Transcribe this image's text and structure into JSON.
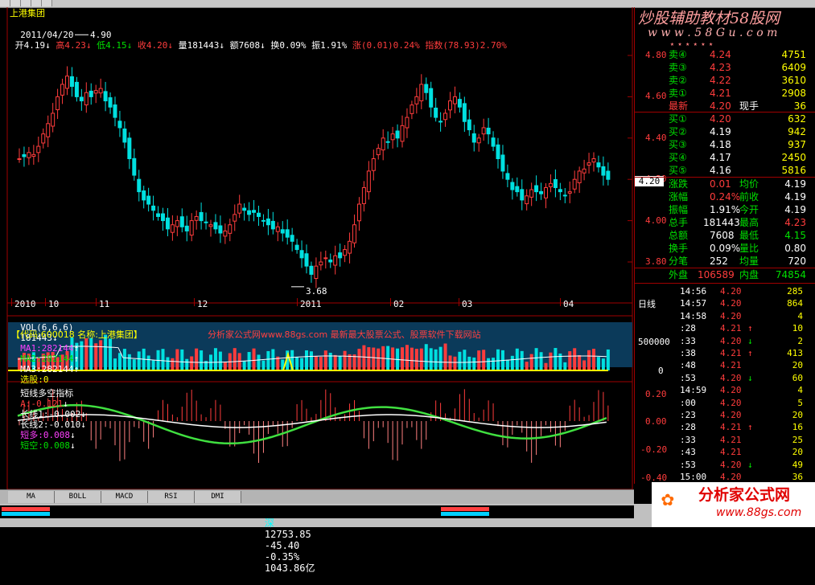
{
  "header": {
    "stock_name": "上港集团",
    "date": "2011/04/20",
    "stats": [
      {
        "label": "开",
        "value": "4.19",
        "arrow": "↓",
        "color": "#ffffff"
      },
      {
        "label": "高",
        "value": "4.23",
        "arrow": "↓",
        "color": "#ff3c3c"
      },
      {
        "label": "低",
        "value": "4.15",
        "arrow": "↓",
        "color": "#00e000"
      },
      {
        "label": "收",
        "value": "4.20",
        "arrow": "↓",
        "color": "#ff3c3c"
      },
      {
        "label": "量",
        "value": "181443",
        "arrow": "↓",
        "color": "#ffffff"
      },
      {
        "label": "额",
        "value": "7608",
        "arrow": "↓",
        "color": "#ffffff"
      },
      {
        "label": "换",
        "value": "0.09%",
        "arrow": "",
        "color": "#ffffff"
      },
      {
        "label": "振",
        "value": "1.91%",
        "arrow": "",
        "color": "#ffffff"
      },
      {
        "label": "涨",
        "value": "(0.01)0.24%",
        "arrow": "",
        "color": "#ff3c3c"
      },
      {
        "label": "指数",
        "value": "(78.93)2.70%",
        "arrow": "",
        "color": "#ff3c3c"
      }
    ]
  },
  "watermark": {
    "title": "炒股辅助教材58股网",
    "url": "w w w . 5 8 G u . c o m",
    "stars": "★ ★ ★ ★ ★ ★"
  },
  "price_axis": {
    "labels": [
      "4.80",
      "4.60",
      "4.40",
      "4.20",
      "4.00",
      "3.80"
    ],
    "current": "4.20",
    "high_label": "4.90",
    "low_label": "3.68"
  },
  "date_axis": {
    "labels": [
      "2010",
      "10",
      "11",
      "12",
      "2011",
      "02",
      "03",
      "04"
    ],
    "period": "日线"
  },
  "volume_panel": {
    "title": "VOL(6,6,6)",
    "vol": "181443",
    "ma1": "MA1:282144",
    "ma2": "MA2:282144",
    "ma3": "MA3:282144",
    "xuangu": "选股:0",
    "banner_code": "【代码:600018 名称:上港集团】",
    "banner_ad": "分析家公式网www.88gs.com 最新最大股票公式、股票软件下载网站",
    "axis": [
      "500000",
      "0"
    ]
  },
  "indicator_panel": {
    "title": "短线多空指标",
    "a": "A:-0.121",
    "long1": "长线1:-0.002",
    "long2": "长线2:-0.010",
    "duo": "短多:0.008",
    "kong": "短空:0.008",
    "axis": [
      "0.20",
      "0.00",
      "-0.20",
      "-0.40"
    ]
  },
  "tabs": [
    "MA",
    "BOLL",
    "MACD",
    "RSI",
    "DMI"
  ],
  "order_book": {
    "sell": [
      {
        "label": "卖④",
        "price": "4.24",
        "vol": "4751"
      },
      {
        "label": "卖③",
        "price": "4.23",
        "vol": "6409"
      },
      {
        "label": "卖②",
        "price": "4.22",
        "vol": "3610"
      },
      {
        "label": "卖①",
        "price": "4.21",
        "vol": "2908"
      }
    ],
    "last": {
      "label": "最新",
      "price": "4.20",
      "label2": "现手",
      "vol": "36"
    },
    "buy": [
      {
        "label": "买①",
        "price": "4.20",
        "vol": "632"
      },
      {
        "label": "买②",
        "price": "4.19",
        "vol": "942"
      },
      {
        "label": "买③",
        "price": "4.18",
        "vol": "937"
      },
      {
        "label": "买④",
        "price": "4.17",
        "vol": "2450"
      },
      {
        "label": "买⑤",
        "price": "4.16",
        "vol": "5816"
      }
    ]
  },
  "stats_block": [
    {
      "l1": "涨跌",
      "v1": "0.01",
      "l2": "均价",
      "v2": "4.19",
      "c1": "#ff3c3c",
      "c2": "#ffffff"
    },
    {
      "l1": "涨幅",
      "v1": "0.24%",
      "l2": "前收",
      "v2": "4.19",
      "c1": "#ff3c3c",
      "c2": "#ffffff"
    },
    {
      "l1": "振幅",
      "v1": "1.91%",
      "l2": "今开",
      "v2": "4.19",
      "c1": "#ffffff",
      "c2": "#ffffff"
    },
    {
      "l1": "总手",
      "v1": "181443",
      "l2": "最高",
      "v2": "4.23",
      "c1": "#ffffff",
      "c2": "#ff3c3c"
    },
    {
      "l1": "总额",
      "v1": "7608",
      "l2": "最低",
      "v2": "4.15",
      "c1": "#ffffff",
      "c2": "#00e000"
    },
    {
      "l1": "换手",
      "v1": "0.09%",
      "l2": "量比",
      "v2": "0.80",
      "c1": "#ffffff",
      "c2": "#ffffff"
    },
    {
      "l1": "分笔",
      "v1": "252",
      "l2": "均量",
      "v2": "720",
      "c1": "#ffffff",
      "c2": "#ffffff"
    }
  ],
  "waipan": {
    "l1": "外盘",
    "v1": "106589",
    "l2": "内盘",
    "v2": "74854"
  },
  "ticks": [
    {
      "time": "14:56",
      "price": "4.20",
      "arrow": "",
      "vol": "285"
    },
    {
      "time": "14:57",
      "price": "4.20",
      "arrow": "",
      "vol": "864"
    },
    {
      "time": "14:58",
      "price": "4.20",
      "arrow": "",
      "vol": "4"
    },
    {
      "time": ":28",
      "price": "4.21",
      "arrow": "↑",
      "vol": "10"
    },
    {
      "time": ":33",
      "price": "4.20",
      "arrow": "↓",
      "vol": "2"
    },
    {
      "time": ":38",
      "price": "4.21",
      "arrow": "↑",
      "vol": "413"
    },
    {
      "time": ":48",
      "price": "4.21",
      "arrow": "",
      "vol": "20"
    },
    {
      "time": ":53",
      "price": "4.20",
      "arrow": "↓",
      "vol": "60"
    },
    {
      "time": "14:59",
      "price": "4.20",
      "arrow": "",
      "vol": "4"
    },
    {
      "time": ":00",
      "price": "4.20",
      "arrow": "",
      "vol": "5"
    },
    {
      "time": ":23",
      "price": "4.20",
      "arrow": "",
      "vol": "20"
    },
    {
      "time": ":28",
      "price": "4.21",
      "arrow": "↑",
      "vol": "16"
    },
    {
      "time": ":33",
      "price": "4.21",
      "arrow": "",
      "vol": "25"
    },
    {
      "time": ":43",
      "price": "4.21",
      "arrow": "",
      "vol": "20"
    },
    {
      "time": ":53",
      "price": "4.20",
      "arrow": "↓",
      "vol": "49"
    },
    {
      "time": "15:00",
      "price": "4.20",
      "arrow": "",
      "vol": "36"
    }
  ],
  "ticker": {
    "market": "深",
    "index": "12753.85",
    "change": "-45.40",
    "pct": "-0.35%",
    "amount": "1043.86亿"
  },
  "logo": {
    "title": "分析家公式网",
    "url": "www.88gs.com"
  },
  "colors": {
    "up": "#ff3c3c",
    "down": "#00e0e0",
    "frame": "#a00000",
    "panel_bg": "#000000"
  }
}
